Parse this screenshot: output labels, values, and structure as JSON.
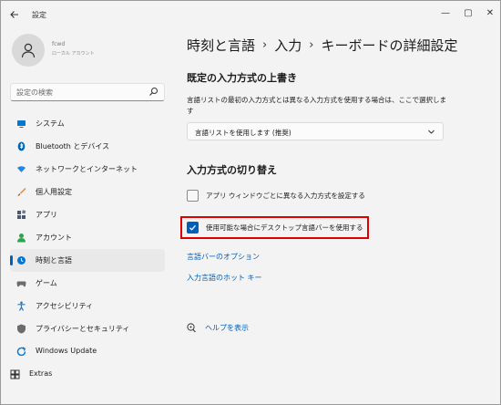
{
  "window": {
    "app_title": "設定",
    "controls": {
      "minimize": "—",
      "maximize": "▢",
      "close": "✕"
    }
  },
  "profile": {
    "name": "fcwd",
    "sub": "ローカル アカウント"
  },
  "search": {
    "placeholder": "設定の検索"
  },
  "sidebar": {
    "items": [
      {
        "label": "システム",
        "icon": "monitor-icon",
        "color": "#0078d4"
      },
      {
        "label": "Bluetooth とデバイス",
        "icon": "bluetooth-icon",
        "color": "#0063b1"
      },
      {
        "label": "ネットワークとインターネット",
        "icon": "network-icon",
        "color": "#1e88e5"
      },
      {
        "label": "個人用設定",
        "icon": "brush-icon",
        "color": "#e8892b"
      },
      {
        "label": "アプリ",
        "icon": "apps-icon",
        "color": "#4a5a6a"
      },
      {
        "label": "アカウント",
        "icon": "account-icon",
        "color": "#2ea44f"
      },
      {
        "label": "時刻と言語",
        "icon": "globe-clock-icon",
        "color": "#0078d4",
        "active": true
      },
      {
        "label": "ゲーム",
        "icon": "gamepad-icon",
        "color": "#6b6b6b"
      },
      {
        "label": "アクセシビリティ",
        "icon": "accessibility-icon",
        "color": "#1a73c8"
      },
      {
        "label": "プライバシーとセキュリティ",
        "icon": "shield-icon",
        "color": "#6b6b6b"
      },
      {
        "label": "Windows Update",
        "icon": "update-icon",
        "color": "#0078d4"
      },
      {
        "label": "Extras",
        "icon": "grid-icon",
        "color": "#333333"
      }
    ]
  },
  "breadcrumb": {
    "parts": [
      "時刻と言語",
      "入力",
      "キーボードの詳細設定"
    ],
    "separator": "›"
  },
  "override": {
    "title": "既定の入力方式の上書き",
    "description": "言語リストの最初の入力方式とは異なる入力方式を使用する場合は、ここで選択します",
    "dropdown_value": "言語リストを使用します (推奨)"
  },
  "switching": {
    "title": "入力方式の切り替え",
    "per_app_label": "アプリ ウィンドウごとに異なる入力方式を設定する",
    "per_app_checked": false,
    "desktop_bar_label": "使用可能な場合にデスクトップ言語バーを使用する",
    "desktop_bar_checked": true
  },
  "links": {
    "language_bar_options": "言語バーのオプション",
    "input_language_hotkeys": "入力言語のホット キー",
    "help": "ヘルプを表示"
  },
  "colors": {
    "accent": "#005fb8",
    "highlight": "#e00000"
  }
}
